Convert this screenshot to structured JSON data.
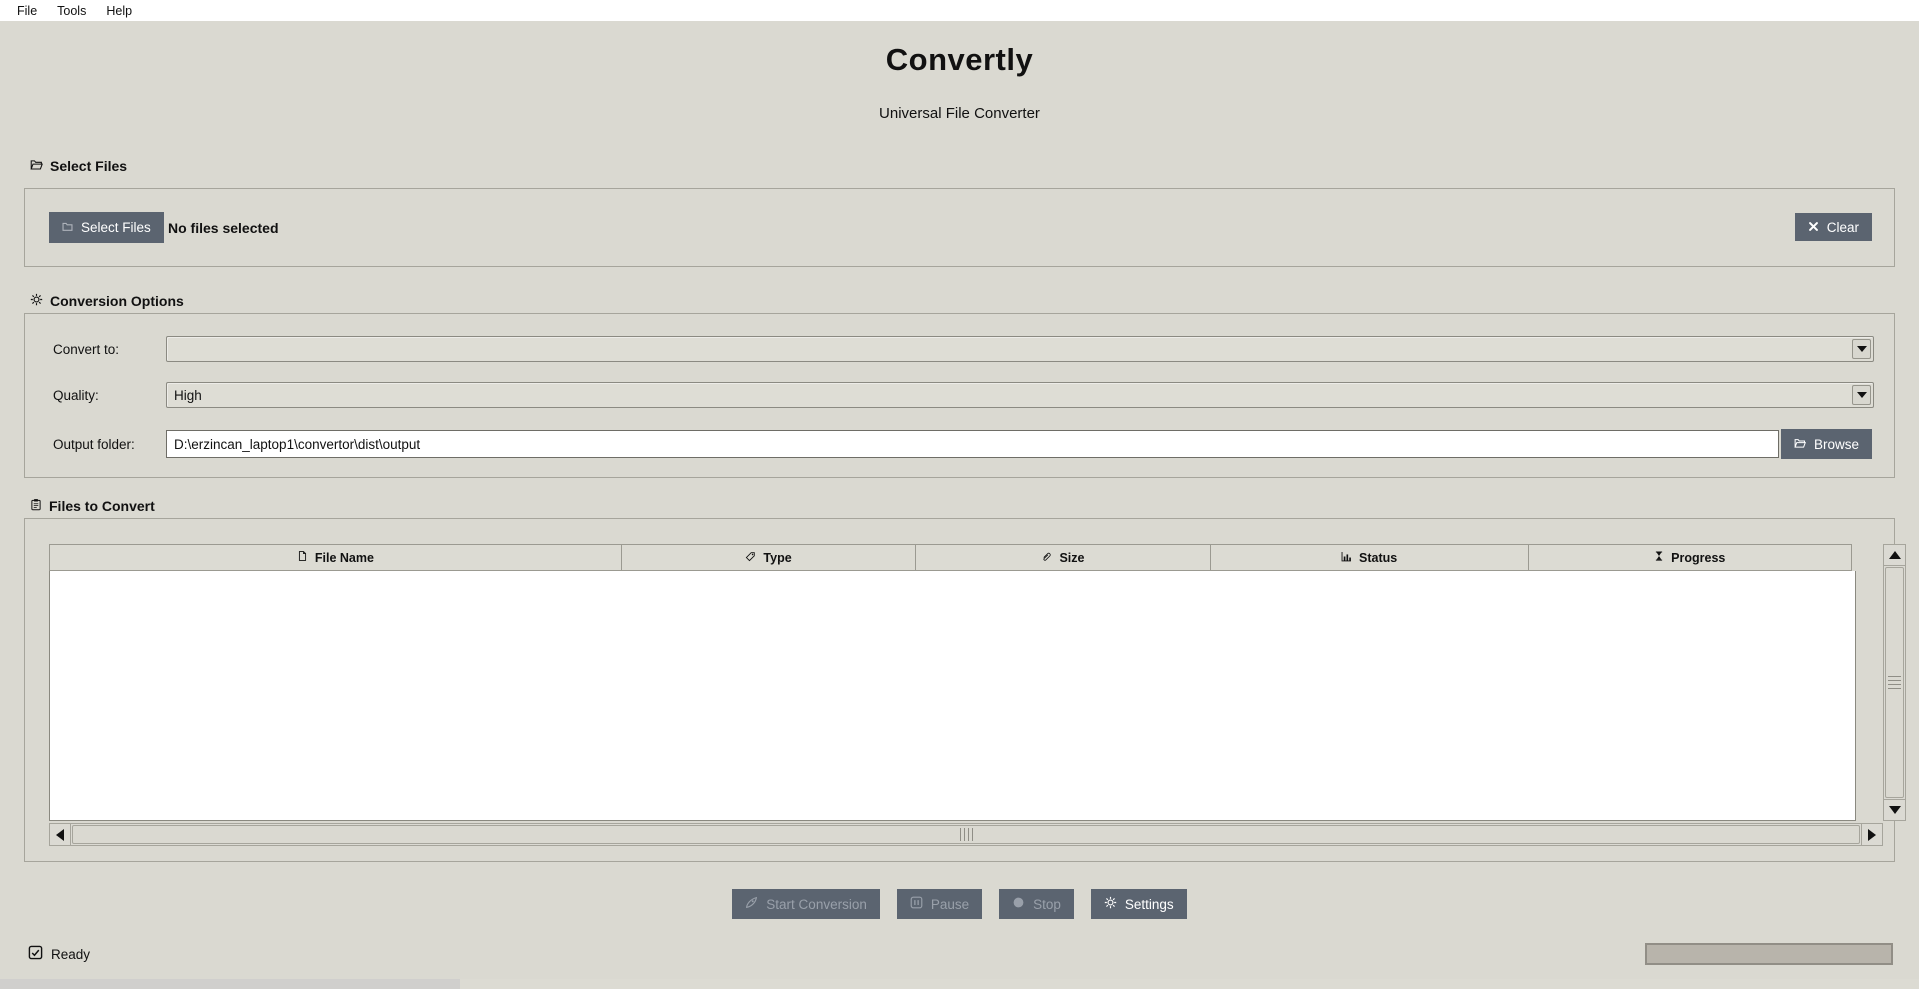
{
  "window": {
    "menu_items": [
      "File",
      "Tools",
      "Help"
    ]
  },
  "header": {
    "title": "Convertly",
    "subtitle": "Universal File Converter"
  },
  "select_files": {
    "section_label": "Select Files",
    "section_icon": "open-folder-icon",
    "select_button_label": "Select Files",
    "select_button_icon": "folder-icon",
    "files_status_text": "No files selected",
    "clear_button_label": "Clear",
    "clear_button_icon": "x-icon"
  },
  "conversion_options": {
    "section_label": "Conversion Options",
    "section_icon": "gear-icon",
    "convert_to": {
      "label": "Convert to:",
      "value": ""
    },
    "quality": {
      "label": "Quality:",
      "value": "High"
    },
    "output_folder": {
      "label": "Output folder:",
      "value": "D:\\erzincan_laptop1\\convertor\\dist\\output"
    },
    "browse_button_label": "Browse",
    "browse_button_icon": "open-folder-icon"
  },
  "files_to_convert": {
    "section_label": "Files to Convert",
    "section_icon": "clipboard-icon",
    "columns": [
      {
        "label": "File Name",
        "icon": "document-icon"
      },
      {
        "label": "Type",
        "icon": "tag-icon"
      },
      {
        "label": "Size",
        "icon": "paperclip-icon"
      },
      {
        "label": "Status",
        "icon": "bar-chart-icon"
      },
      {
        "label": "Progress",
        "icon": "hourglass-icon"
      }
    ],
    "rows": []
  },
  "actions": {
    "start_label": "Start Conversion",
    "start_icon": "rocket-icon",
    "start_enabled": false,
    "pause_label": "Pause",
    "pause_icon": "pause-icon",
    "pause_enabled": false,
    "stop_label": "Stop",
    "stop_icon": "stop-icon",
    "stop_enabled": false,
    "settings_label": "Settings",
    "settings_icon": "gear-icon",
    "settings_enabled": true
  },
  "status_bar": {
    "status_text": "Ready",
    "status_icon": "checkbox-checked-icon",
    "progress_percent": 0
  },
  "colors": {
    "background": "#dad9d1",
    "menu_bg": "#ffffff",
    "button_dark": "#5b6470",
    "button_disabled_text": "#99a0aa",
    "field_white": "#ffffff",
    "combobox_field": "#deddd5",
    "table_header_bg": "#dcdbd3",
    "progress_trough": "#b8b4ab"
  }
}
